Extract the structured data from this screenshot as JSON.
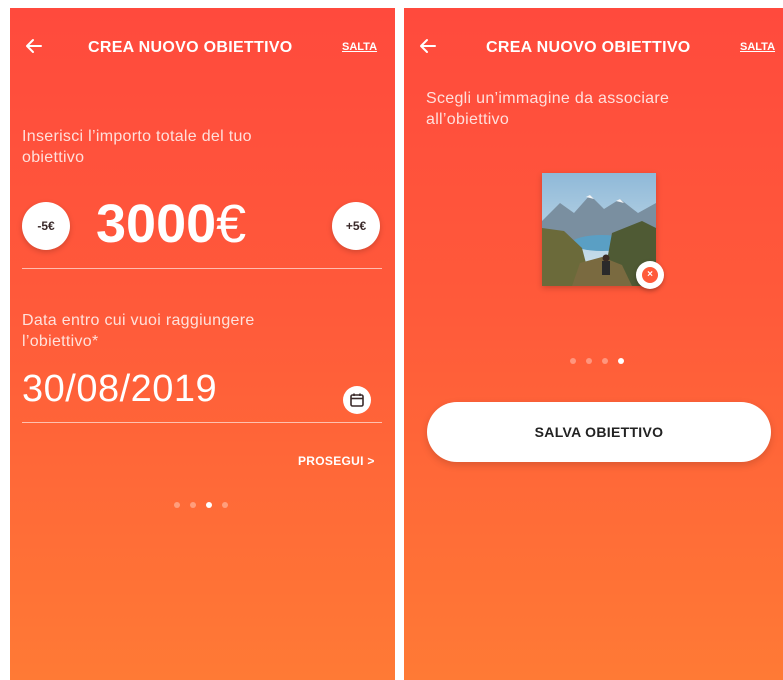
{
  "colors": {
    "gradient_top": "#ff4a3d",
    "gradient_bottom": "#ff7a35",
    "accent": "#ff5a3a",
    "text_on_accent": "#ffffff"
  },
  "left_screen": {
    "header": {
      "back_icon": "arrow-left-icon",
      "title": "CREA NUOVO OBIETTIVO",
      "skip_label": "SALTA"
    },
    "amount_section": {
      "prompt": "Inserisci l’importo totale del tuo obiettivo",
      "decrement_label": "-5€",
      "increment_label": "+5€",
      "amount_value": "3000",
      "currency": "€"
    },
    "date_section": {
      "prompt": "Data entro cui vuoi raggiungere l’obiettivo*",
      "date_value": "30/08/2019",
      "calendar_icon": "calendar-icon"
    },
    "next_label": "PROSEGUI >",
    "pagination": {
      "total": 4,
      "active": 3
    }
  },
  "right_screen": {
    "header": {
      "back_icon": "arrow-left-icon",
      "title": "CREA NUOVO OBIETTIVO",
      "skip_label": "SALTA"
    },
    "prompt": "Scegli un’immagine da associare all’obiettivo",
    "image": {
      "description_icon": "mountain-lake-photo",
      "remove_label": "×"
    },
    "pagination": {
      "total": 4,
      "active": 4
    },
    "save_label": "SALVA OBIETTIVO"
  }
}
